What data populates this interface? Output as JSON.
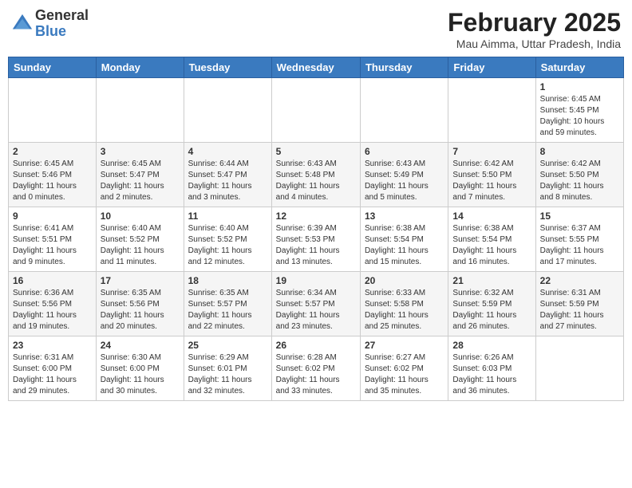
{
  "header": {
    "logo_general": "General",
    "logo_blue": "Blue",
    "title": "February 2025",
    "subtitle": "Mau Aimma, Uttar Pradesh, India"
  },
  "days_of_week": [
    "Sunday",
    "Monday",
    "Tuesday",
    "Wednesday",
    "Thursday",
    "Friday",
    "Saturday"
  ],
  "weeks": [
    [
      {
        "day": "",
        "info": ""
      },
      {
        "day": "",
        "info": ""
      },
      {
        "day": "",
        "info": ""
      },
      {
        "day": "",
        "info": ""
      },
      {
        "day": "",
        "info": ""
      },
      {
        "day": "",
        "info": ""
      },
      {
        "day": "1",
        "info": "Sunrise: 6:45 AM\nSunset: 5:45 PM\nDaylight: 10 hours\nand 59 minutes."
      }
    ],
    [
      {
        "day": "2",
        "info": "Sunrise: 6:45 AM\nSunset: 5:46 PM\nDaylight: 11 hours\nand 0 minutes."
      },
      {
        "day": "3",
        "info": "Sunrise: 6:45 AM\nSunset: 5:47 PM\nDaylight: 11 hours\nand 2 minutes."
      },
      {
        "day": "4",
        "info": "Sunrise: 6:44 AM\nSunset: 5:47 PM\nDaylight: 11 hours\nand 3 minutes."
      },
      {
        "day": "5",
        "info": "Sunrise: 6:43 AM\nSunset: 5:48 PM\nDaylight: 11 hours\nand 4 minutes."
      },
      {
        "day": "6",
        "info": "Sunrise: 6:43 AM\nSunset: 5:49 PM\nDaylight: 11 hours\nand 5 minutes."
      },
      {
        "day": "7",
        "info": "Sunrise: 6:42 AM\nSunset: 5:50 PM\nDaylight: 11 hours\nand 7 minutes."
      },
      {
        "day": "8",
        "info": "Sunrise: 6:42 AM\nSunset: 5:50 PM\nDaylight: 11 hours\nand 8 minutes."
      }
    ],
    [
      {
        "day": "9",
        "info": "Sunrise: 6:41 AM\nSunset: 5:51 PM\nDaylight: 11 hours\nand 9 minutes."
      },
      {
        "day": "10",
        "info": "Sunrise: 6:40 AM\nSunset: 5:52 PM\nDaylight: 11 hours\nand 11 minutes."
      },
      {
        "day": "11",
        "info": "Sunrise: 6:40 AM\nSunset: 5:52 PM\nDaylight: 11 hours\nand 12 minutes."
      },
      {
        "day": "12",
        "info": "Sunrise: 6:39 AM\nSunset: 5:53 PM\nDaylight: 11 hours\nand 13 minutes."
      },
      {
        "day": "13",
        "info": "Sunrise: 6:38 AM\nSunset: 5:54 PM\nDaylight: 11 hours\nand 15 minutes."
      },
      {
        "day": "14",
        "info": "Sunrise: 6:38 AM\nSunset: 5:54 PM\nDaylight: 11 hours\nand 16 minutes."
      },
      {
        "day": "15",
        "info": "Sunrise: 6:37 AM\nSunset: 5:55 PM\nDaylight: 11 hours\nand 17 minutes."
      }
    ],
    [
      {
        "day": "16",
        "info": "Sunrise: 6:36 AM\nSunset: 5:56 PM\nDaylight: 11 hours\nand 19 minutes."
      },
      {
        "day": "17",
        "info": "Sunrise: 6:35 AM\nSunset: 5:56 PM\nDaylight: 11 hours\nand 20 minutes."
      },
      {
        "day": "18",
        "info": "Sunrise: 6:35 AM\nSunset: 5:57 PM\nDaylight: 11 hours\nand 22 minutes."
      },
      {
        "day": "19",
        "info": "Sunrise: 6:34 AM\nSunset: 5:57 PM\nDaylight: 11 hours\nand 23 minutes."
      },
      {
        "day": "20",
        "info": "Sunrise: 6:33 AM\nSunset: 5:58 PM\nDaylight: 11 hours\nand 25 minutes."
      },
      {
        "day": "21",
        "info": "Sunrise: 6:32 AM\nSunset: 5:59 PM\nDaylight: 11 hours\nand 26 minutes."
      },
      {
        "day": "22",
        "info": "Sunrise: 6:31 AM\nSunset: 5:59 PM\nDaylight: 11 hours\nand 27 minutes."
      }
    ],
    [
      {
        "day": "23",
        "info": "Sunrise: 6:31 AM\nSunset: 6:00 PM\nDaylight: 11 hours\nand 29 minutes."
      },
      {
        "day": "24",
        "info": "Sunrise: 6:30 AM\nSunset: 6:00 PM\nDaylight: 11 hours\nand 30 minutes."
      },
      {
        "day": "25",
        "info": "Sunrise: 6:29 AM\nSunset: 6:01 PM\nDaylight: 11 hours\nand 32 minutes."
      },
      {
        "day": "26",
        "info": "Sunrise: 6:28 AM\nSunset: 6:02 PM\nDaylight: 11 hours\nand 33 minutes."
      },
      {
        "day": "27",
        "info": "Sunrise: 6:27 AM\nSunset: 6:02 PM\nDaylight: 11 hours\nand 35 minutes."
      },
      {
        "day": "28",
        "info": "Sunrise: 6:26 AM\nSunset: 6:03 PM\nDaylight: 11 hours\nand 36 minutes."
      },
      {
        "day": "",
        "info": ""
      }
    ]
  ]
}
